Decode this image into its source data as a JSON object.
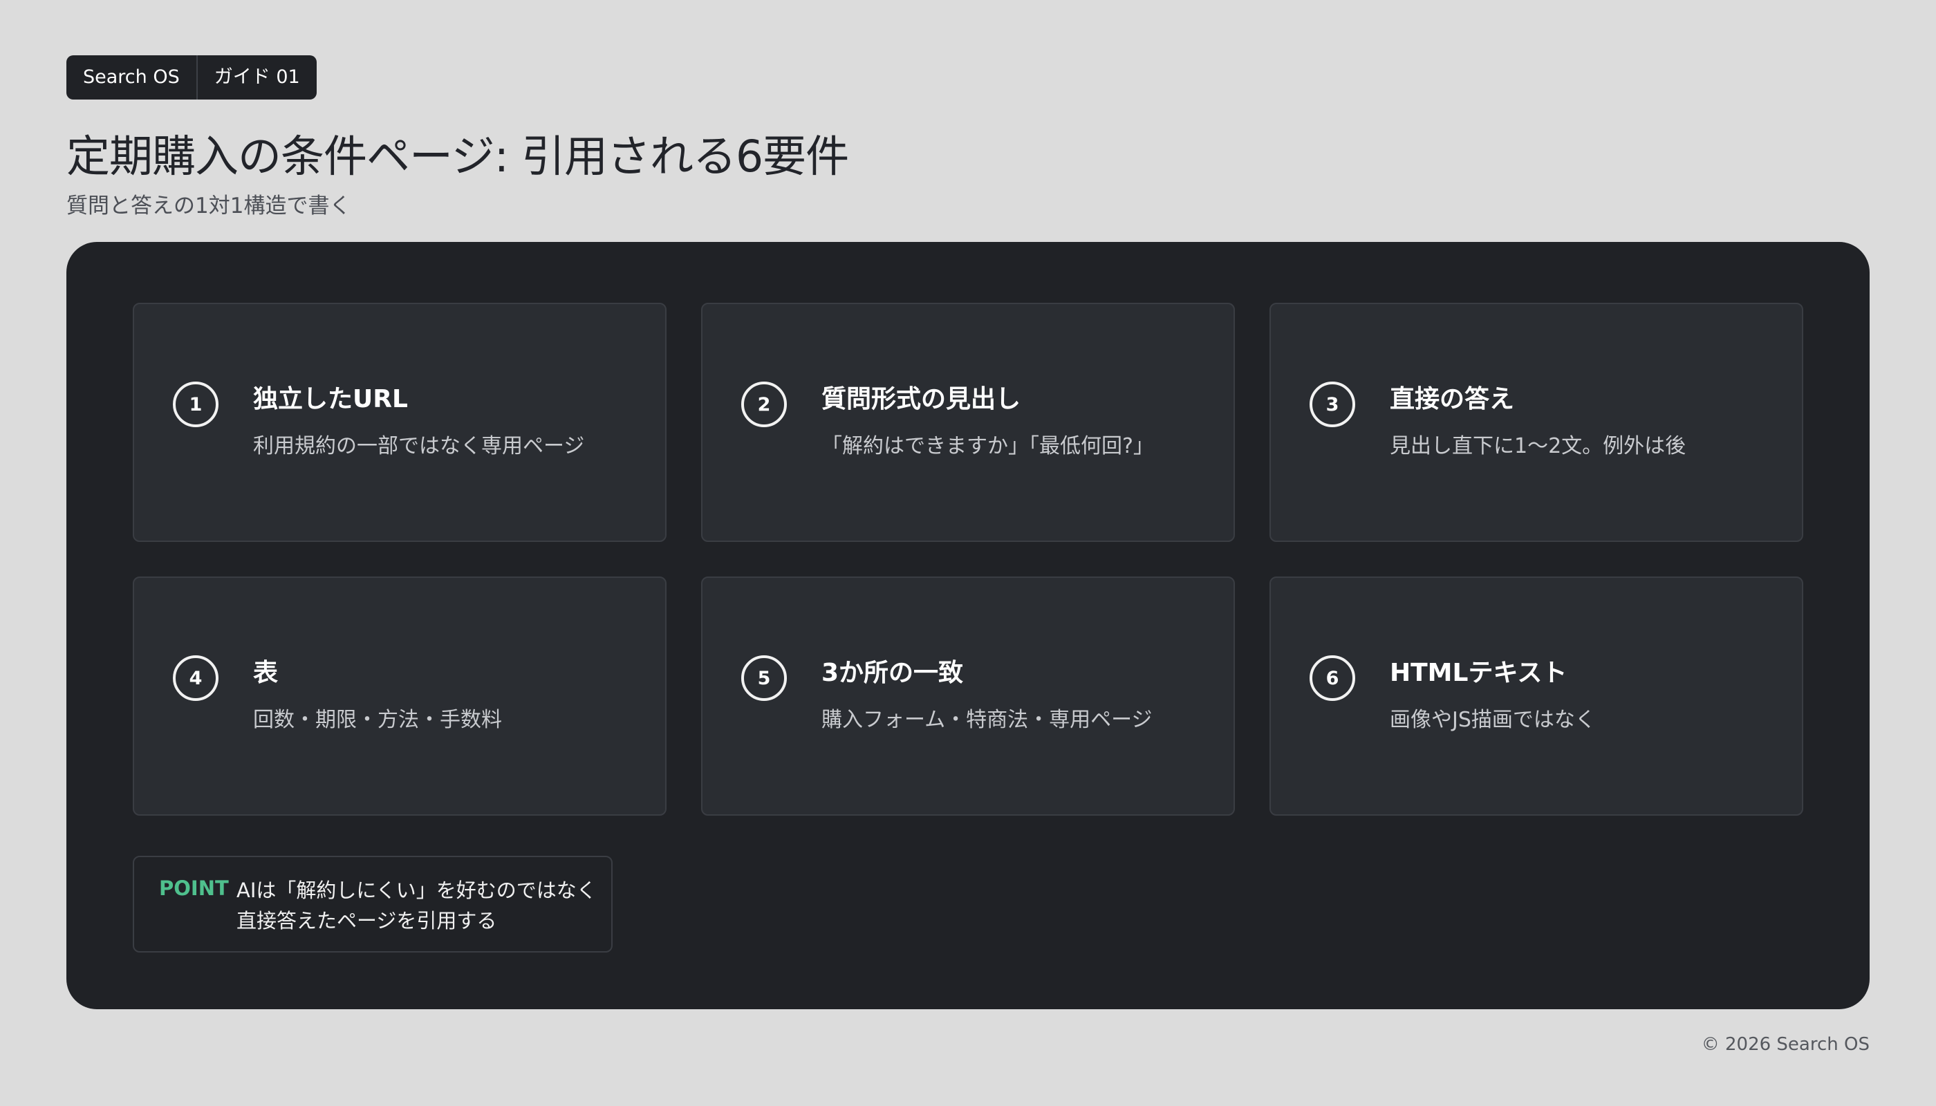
{
  "breadcrumb": {
    "brand": "Search OS",
    "section": "ガイド 01"
  },
  "header": {
    "title": "定期購入の条件ページ: 引用される6要件",
    "subtitle": "質問と答えの1対1構造で書く"
  },
  "cards": [
    {
      "number": "1",
      "title": "独立したURL",
      "description": "利用規約の一部ではなく専用ページ"
    },
    {
      "number": "2",
      "title": "質問形式の見出し",
      "description": "「解約はできますか」「最低何回?」"
    },
    {
      "number": "3",
      "title": "直接の答え",
      "description": "見出し直下に1〜2文。例外は後"
    },
    {
      "number": "4",
      "title": "表",
      "description": "回数・期限・方法・手数料"
    },
    {
      "number": "5",
      "title": "3か所の一致",
      "description": "購入フォーム・特商法・専用ページ"
    },
    {
      "number": "6",
      "title": "HTMLテキスト",
      "description": "画像やJS描画ではなく"
    }
  ],
  "point": {
    "label": "POINT",
    "text_line1": "AIは「解約しにくい」を好むのではなく",
    "text_line2": "直接答えたページを引用する"
  },
  "footer": {
    "copyright": "© 2026 Search OS"
  },
  "colors": {
    "background": "#dcdcdc",
    "panel": "#202226",
    "card": "#2a2d32",
    "accent": "#4fc08d"
  }
}
